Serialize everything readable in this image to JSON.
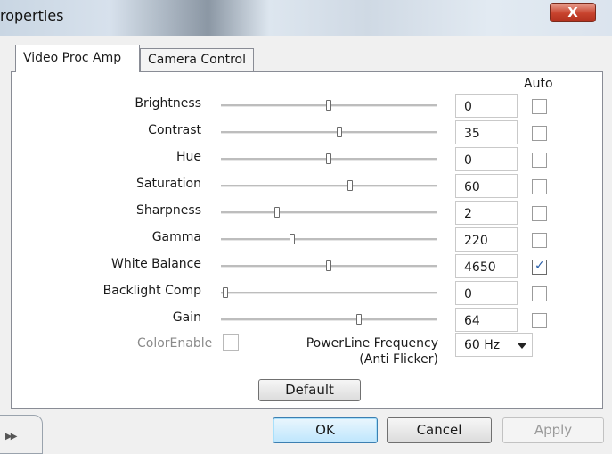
{
  "window": {
    "title": "roperties",
    "close_glyph": "X"
  },
  "tabs": [
    {
      "label": "Video Proc Amp",
      "active": true
    },
    {
      "label": "Camera Control",
      "active": false
    }
  ],
  "auto_header": "Auto",
  "properties": [
    {
      "label": "Brightness",
      "value": "0",
      "slider_fraction": 0.5,
      "auto": false
    },
    {
      "label": "Contrast",
      "value": "35",
      "slider_fraction": 0.55,
      "auto": false
    },
    {
      "label": "Hue",
      "value": "0",
      "slider_fraction": 0.5,
      "auto": false
    },
    {
      "label": "Saturation",
      "value": "60",
      "slider_fraction": 0.6,
      "auto": false
    },
    {
      "label": "Sharpness",
      "value": "2",
      "slider_fraction": 0.26,
      "auto": false
    },
    {
      "label": "Gamma",
      "value": "220",
      "slider_fraction": 0.33,
      "auto": false
    },
    {
      "label": "White Balance",
      "value": "4650",
      "slider_fraction": 0.5,
      "auto": true
    },
    {
      "label": "Backlight Comp",
      "value": "0",
      "slider_fraction": 0.02,
      "auto": false
    },
    {
      "label": "Gain",
      "value": "64",
      "slider_fraction": 0.64,
      "auto": false
    }
  ],
  "color_enable": {
    "label": "ColorEnable",
    "checked": false
  },
  "powerline": {
    "label_line1": "PowerLine Frequency",
    "label_line2": "(Anti Flicker)",
    "selected": "60 Hz"
  },
  "buttons": {
    "default": "Default",
    "ok": "OK",
    "cancel": "Cancel",
    "apply": "Apply"
  },
  "icons": {
    "expand": "double-chevron-right-icon",
    "close": "close-icon",
    "checkmark": "checkmark-icon"
  }
}
